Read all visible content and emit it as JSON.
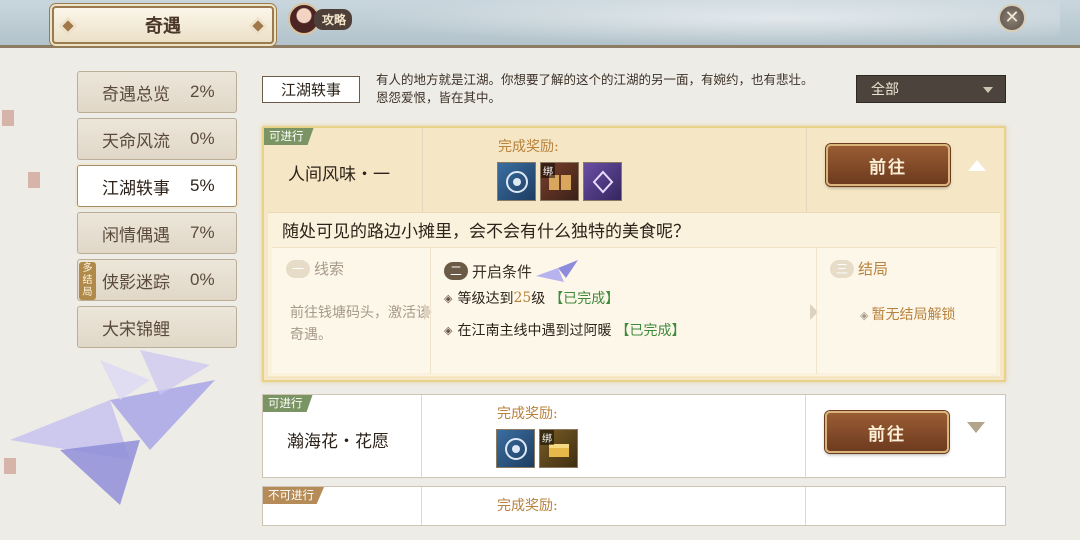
{
  "header": {
    "title": "奇遇",
    "guide_label": "攻略",
    "close_symbol": "✕"
  },
  "sidebar": {
    "items": [
      {
        "label": "奇遇总览",
        "percent": "2%"
      },
      {
        "label": "天命风流",
        "percent": "0%"
      },
      {
        "label": "江湖轶事",
        "percent": "5%",
        "active": true
      },
      {
        "label": "闲情偶遇",
        "percent": "7%"
      },
      {
        "label": "侠影迷踪",
        "percent": "0%",
        "tag": "多结局"
      },
      {
        "label": "大宋锦鲤",
        "percent": ""
      }
    ]
  },
  "section": {
    "tag": "江湖轶事",
    "description": "有人的地方就是江湖。你想要了解的这个的江湖的另一面，有婉约，也有悲壮。恩怨爱恨，皆在其中。",
    "filter": "全部"
  },
  "cards": [
    {
      "status": "可进行",
      "name": "人间风味・一",
      "reward_label": "完成奖励:",
      "items": [
        {
          "icon": "orb-icon",
          "color": "blue",
          "bind": ""
        },
        {
          "icon": "book-icon",
          "color": "brown",
          "bind": "绑"
        },
        {
          "icon": "fan-icon",
          "color": "purple",
          "bind": ""
        }
      ],
      "go_label": "前往",
      "question": "随处可见的路边小摊里，会不会有什么独特的美食呢？",
      "steps": {
        "clue": {
          "num": "一",
          "title": "线索",
          "text": "前往钱塘码头，激活该奇遇。"
        },
        "condition": {
          "num": "二",
          "title": "开启条件",
          "lines": [
            {
              "text": "等级达到",
              "level": "25",
              "suffix": "级",
              "status": "【已完成】"
            },
            {
              "text": "在江南主线中遇到过阿暖",
              "status": "【已完成】"
            }
          ]
        },
        "ending": {
          "num": "三",
          "title": "结局",
          "text": "暂无结局解锁"
        }
      }
    },
    {
      "status": "可进行",
      "name": "瀚海花・花愿",
      "reward_label": "完成奖励:",
      "items": [
        {
          "icon": "orb-icon",
          "color": "blue",
          "bind": ""
        },
        {
          "icon": "treasure-chest-icon",
          "color": "gold",
          "bind": "绑"
        }
      ],
      "go_label": "前往"
    },
    {
      "status": "不可进行",
      "reward_label": "完成奖励:"
    }
  ],
  "colors": {
    "accent_gold": "#b8823c",
    "done_green": "#3f8a3a",
    "button_brown": "#7d4727",
    "status_green": "#7a9463"
  }
}
